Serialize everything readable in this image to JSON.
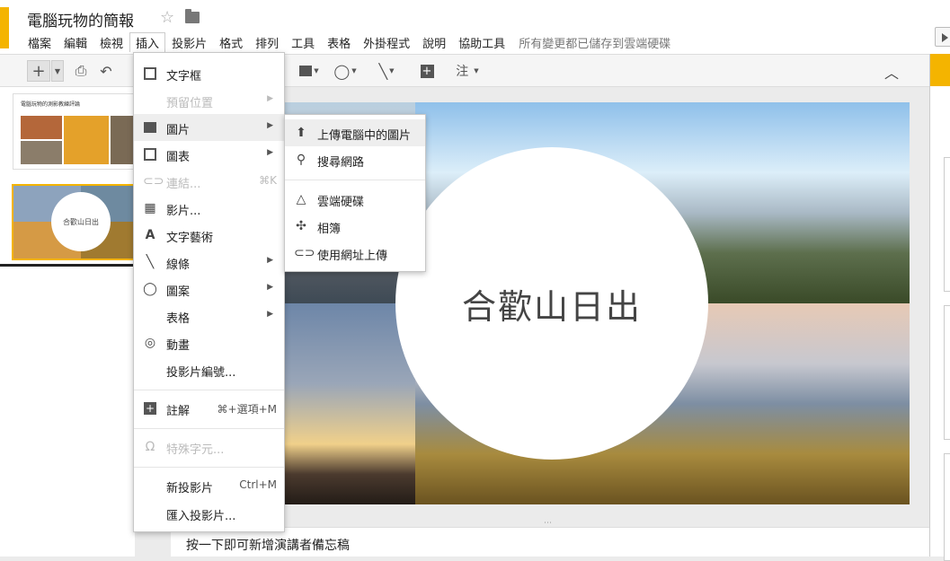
{
  "app": {
    "title": "電腦玩物的簡報",
    "save_status": "所有變更都已儲存到雲端硬碟"
  },
  "menubar": [
    "檔案",
    "編輯",
    "檢視",
    "插入",
    "投影片",
    "格式",
    "排列",
    "工具",
    "表格",
    "外掛程式",
    "說明",
    "協助工具"
  ],
  "active_menu": "插入",
  "toolbar": {
    "comment_label": "注"
  },
  "filmstrip": {
    "slides": [
      {
        "number": "1",
        "title": "電腦玩物的測影教練評論"
      },
      {
        "number": "2",
        "circle_text": "合歡山日出"
      }
    ]
  },
  "slide": {
    "title": "合歡山日出"
  },
  "notes": {
    "placeholder": "按一下即可新增演講者備忘稿"
  },
  "insert_menu": {
    "items": [
      {
        "label": "文字框",
        "icon": "textbox-icon",
        "disabled": false
      },
      {
        "label": "預留位置",
        "icon": "",
        "disabled": true,
        "submenu": true
      },
      {
        "label": "圖片",
        "icon": "image-icon",
        "disabled": false,
        "submenu": true,
        "hover": true
      },
      {
        "label": "圖表",
        "icon": "chart-icon",
        "disabled": false,
        "submenu": true
      },
      {
        "label": "連結...",
        "icon": "link-icon",
        "disabled": true,
        "shortcut": "⌘K"
      },
      {
        "label": "影片...",
        "icon": "video-icon",
        "disabled": false
      },
      {
        "label": "文字藝術",
        "icon": "wordart-icon",
        "disabled": false
      },
      {
        "label": "線條",
        "icon": "line-icon",
        "disabled": false,
        "submenu": true
      },
      {
        "label": "圖案",
        "icon": "shape-icon",
        "disabled": false,
        "submenu": true
      },
      {
        "label": "表格",
        "icon": "",
        "disabled": false,
        "submenu": true
      },
      {
        "label": "動畫",
        "icon": "animation-icon",
        "disabled": false
      },
      {
        "label": "投影片編號...",
        "icon": "",
        "disabled": false
      },
      {
        "label": "註解",
        "icon": "comment-icon",
        "disabled": false,
        "shortcut": "⌘+選項+M"
      },
      {
        "label": "特殊字元...",
        "icon": "omega-icon",
        "disabled": true
      },
      {
        "label": "新投影片",
        "icon": "",
        "disabled": false,
        "shortcut": "Ctrl+M"
      },
      {
        "label": "匯入投影片...",
        "icon": "",
        "disabled": false
      }
    ]
  },
  "image_submenu": {
    "items": [
      {
        "label": "上傳電腦中的圖片",
        "icon": "upload-icon",
        "hover": true
      },
      {
        "label": "搜尋網路",
        "icon": "search-icon"
      },
      {
        "label": "雲端硬碟",
        "icon": "drive-icon"
      },
      {
        "label": "相簿",
        "icon": "photos-icon"
      },
      {
        "label": "使用網址上傳",
        "icon": "link-icon"
      }
    ]
  },
  "colors": {
    "brand": "#f4b400",
    "menu_hover": "#eeeeee",
    "disabled_text": "#bbbbbb"
  }
}
